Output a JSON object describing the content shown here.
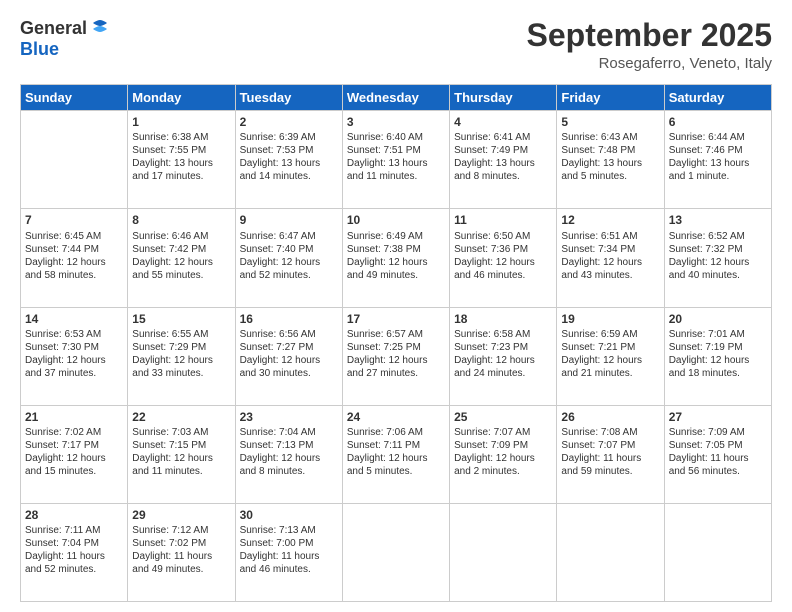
{
  "logo": {
    "general": "General",
    "blue": "Blue"
  },
  "header": {
    "month": "September 2025",
    "location": "Rosegaferro, Veneto, Italy"
  },
  "weekdays": [
    "Sunday",
    "Monday",
    "Tuesday",
    "Wednesday",
    "Thursday",
    "Friday",
    "Saturday"
  ],
  "weeks": [
    [
      {
        "day": "",
        "info": ""
      },
      {
        "day": "1",
        "info": "Sunrise: 6:38 AM\nSunset: 7:55 PM\nDaylight: 13 hours\nand 17 minutes."
      },
      {
        "day": "2",
        "info": "Sunrise: 6:39 AM\nSunset: 7:53 PM\nDaylight: 13 hours\nand 14 minutes."
      },
      {
        "day": "3",
        "info": "Sunrise: 6:40 AM\nSunset: 7:51 PM\nDaylight: 13 hours\nand 11 minutes."
      },
      {
        "day": "4",
        "info": "Sunrise: 6:41 AM\nSunset: 7:49 PM\nDaylight: 13 hours\nand 8 minutes."
      },
      {
        "day": "5",
        "info": "Sunrise: 6:43 AM\nSunset: 7:48 PM\nDaylight: 13 hours\nand 5 minutes."
      },
      {
        "day": "6",
        "info": "Sunrise: 6:44 AM\nSunset: 7:46 PM\nDaylight: 13 hours\nand 1 minute."
      }
    ],
    [
      {
        "day": "7",
        "info": "Sunrise: 6:45 AM\nSunset: 7:44 PM\nDaylight: 12 hours\nand 58 minutes."
      },
      {
        "day": "8",
        "info": "Sunrise: 6:46 AM\nSunset: 7:42 PM\nDaylight: 12 hours\nand 55 minutes."
      },
      {
        "day": "9",
        "info": "Sunrise: 6:47 AM\nSunset: 7:40 PM\nDaylight: 12 hours\nand 52 minutes."
      },
      {
        "day": "10",
        "info": "Sunrise: 6:49 AM\nSunset: 7:38 PM\nDaylight: 12 hours\nand 49 minutes."
      },
      {
        "day": "11",
        "info": "Sunrise: 6:50 AM\nSunset: 7:36 PM\nDaylight: 12 hours\nand 46 minutes."
      },
      {
        "day": "12",
        "info": "Sunrise: 6:51 AM\nSunset: 7:34 PM\nDaylight: 12 hours\nand 43 minutes."
      },
      {
        "day": "13",
        "info": "Sunrise: 6:52 AM\nSunset: 7:32 PM\nDaylight: 12 hours\nand 40 minutes."
      }
    ],
    [
      {
        "day": "14",
        "info": "Sunrise: 6:53 AM\nSunset: 7:30 PM\nDaylight: 12 hours\nand 37 minutes."
      },
      {
        "day": "15",
        "info": "Sunrise: 6:55 AM\nSunset: 7:29 PM\nDaylight: 12 hours\nand 33 minutes."
      },
      {
        "day": "16",
        "info": "Sunrise: 6:56 AM\nSunset: 7:27 PM\nDaylight: 12 hours\nand 30 minutes."
      },
      {
        "day": "17",
        "info": "Sunrise: 6:57 AM\nSunset: 7:25 PM\nDaylight: 12 hours\nand 27 minutes."
      },
      {
        "day": "18",
        "info": "Sunrise: 6:58 AM\nSunset: 7:23 PM\nDaylight: 12 hours\nand 24 minutes."
      },
      {
        "day": "19",
        "info": "Sunrise: 6:59 AM\nSunset: 7:21 PM\nDaylight: 12 hours\nand 21 minutes."
      },
      {
        "day": "20",
        "info": "Sunrise: 7:01 AM\nSunset: 7:19 PM\nDaylight: 12 hours\nand 18 minutes."
      }
    ],
    [
      {
        "day": "21",
        "info": "Sunrise: 7:02 AM\nSunset: 7:17 PM\nDaylight: 12 hours\nand 15 minutes."
      },
      {
        "day": "22",
        "info": "Sunrise: 7:03 AM\nSunset: 7:15 PM\nDaylight: 12 hours\nand 11 minutes."
      },
      {
        "day": "23",
        "info": "Sunrise: 7:04 AM\nSunset: 7:13 PM\nDaylight: 12 hours\nand 8 minutes."
      },
      {
        "day": "24",
        "info": "Sunrise: 7:06 AM\nSunset: 7:11 PM\nDaylight: 12 hours\nand 5 minutes."
      },
      {
        "day": "25",
        "info": "Sunrise: 7:07 AM\nSunset: 7:09 PM\nDaylight: 12 hours\nand 2 minutes."
      },
      {
        "day": "26",
        "info": "Sunrise: 7:08 AM\nSunset: 7:07 PM\nDaylight: 11 hours\nand 59 minutes."
      },
      {
        "day": "27",
        "info": "Sunrise: 7:09 AM\nSunset: 7:05 PM\nDaylight: 11 hours\nand 56 minutes."
      }
    ],
    [
      {
        "day": "28",
        "info": "Sunrise: 7:11 AM\nSunset: 7:04 PM\nDaylight: 11 hours\nand 52 minutes."
      },
      {
        "day": "29",
        "info": "Sunrise: 7:12 AM\nSunset: 7:02 PM\nDaylight: 11 hours\nand 49 minutes."
      },
      {
        "day": "30",
        "info": "Sunrise: 7:13 AM\nSunset: 7:00 PM\nDaylight: 11 hours\nand 46 minutes."
      },
      {
        "day": "",
        "info": ""
      },
      {
        "day": "",
        "info": ""
      },
      {
        "day": "",
        "info": ""
      },
      {
        "day": "",
        "info": ""
      }
    ]
  ]
}
